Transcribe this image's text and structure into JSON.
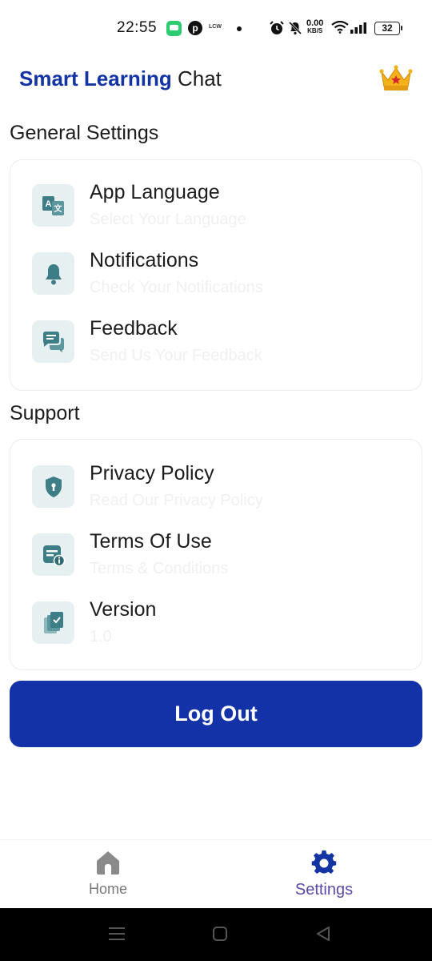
{
  "status_bar": {
    "time": "22:55",
    "carrier_tag": "LCW",
    "net_speed": "0.00",
    "net_speed_unit": "KB/S",
    "battery": "32",
    "icons": [
      "message-icon",
      "pinterest-icon",
      "alarm-icon",
      "mute-icon",
      "wifi-icon",
      "signal-icon",
      "battery-icon"
    ]
  },
  "header": {
    "title_strong": "Smart Learning",
    "title_light": "Chat",
    "premium_icon": "crown-icon",
    "brand_color": "#1434a4"
  },
  "general": {
    "title": "General Settings",
    "items": [
      {
        "title": "App Language",
        "subtitle": "Select Your Language",
        "icon": "translate-icon"
      },
      {
        "title": "Notifications",
        "subtitle": "Check Your Notifications",
        "icon": "bell-icon"
      },
      {
        "title": "Feedback",
        "subtitle": "Send Us Your Feedback",
        "icon": "chat-bubbles-icon"
      }
    ]
  },
  "support": {
    "title": "Support",
    "items": [
      {
        "title": "Privacy Policy",
        "subtitle": "Read Our Privacy Policy",
        "icon": "shield-icon"
      },
      {
        "title": "Terms Of Use",
        "subtitle": "Terms & Conditions",
        "icon": "document-info-icon"
      },
      {
        "title": "Version",
        "subtitle": "1.0",
        "icon": "copy-check-icon"
      }
    ]
  },
  "logout": {
    "label": "Log Out",
    "color": "#1432a8"
  },
  "bottom_nav": {
    "items": [
      {
        "label": "Home",
        "icon": "home-icon",
        "active": false
      },
      {
        "label": "Settings",
        "icon": "gear-icon",
        "active": true
      }
    ]
  },
  "system_nav": {
    "buttons": [
      "menu-icon",
      "home-square-icon",
      "back-triangle-icon"
    ]
  }
}
